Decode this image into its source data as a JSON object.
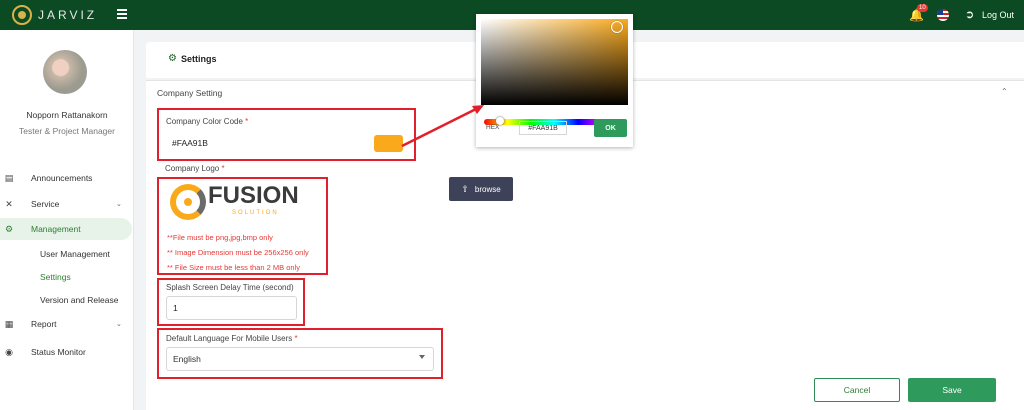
{
  "topbar": {
    "brand": "JARVIZ",
    "notification_count": "10",
    "logout_label": "Log Out"
  },
  "user": {
    "name": "Nopporn Rattanakorn",
    "role": "Tester & Project Manager"
  },
  "sidebar": {
    "items": [
      {
        "label": "Announcements",
        "icon": "announcement-icon"
      },
      {
        "label": "Service",
        "icon": "tools-icon",
        "has_chevron": true
      },
      {
        "label": "Management",
        "icon": "gear-icon",
        "active": true
      },
      {
        "label": "Report",
        "icon": "report-icon",
        "has_chevron": true
      },
      {
        "label": "Status Monitor",
        "icon": "location-pin-icon"
      }
    ],
    "sub_items": [
      {
        "label": "User Management"
      },
      {
        "label": "Settings",
        "active": true
      },
      {
        "label": "Version and Release"
      }
    ]
  },
  "page": {
    "title": "Settings",
    "section_title": "Company Setting"
  },
  "form": {
    "company_color": {
      "label": "Company Color Code",
      "required": "*",
      "value": "#FAA91B",
      "swatch_color": "#FAA91B"
    },
    "company_logo": {
      "label": "Company Logo",
      "required": "*",
      "logo_text": "FUSION",
      "logo_subtext": "SOLUTION",
      "warnings": [
        "**File must be png,jpg,bmp only",
        "** Image Dimension must be 256x256 only",
        "** File Size must be less than 2 MB only"
      ],
      "browse_label": "browse"
    },
    "splash_delay": {
      "label": "Splash Screen Delay Time (second)",
      "value": "1"
    },
    "default_language": {
      "label": "Default Language For Mobile Users",
      "required": "*",
      "value": "English"
    }
  },
  "picker": {
    "hex_label": "HEX",
    "hex_value": "#FAA91B",
    "ok_label": "OK"
  },
  "actions": {
    "cancel_label": "Cancel",
    "save_label": "Save"
  },
  "colors": {
    "topbar": "#0b4a22",
    "accent": "#2e9b5c",
    "brand_orange": "#FAA91B",
    "annotation_red": "#e0202a"
  }
}
